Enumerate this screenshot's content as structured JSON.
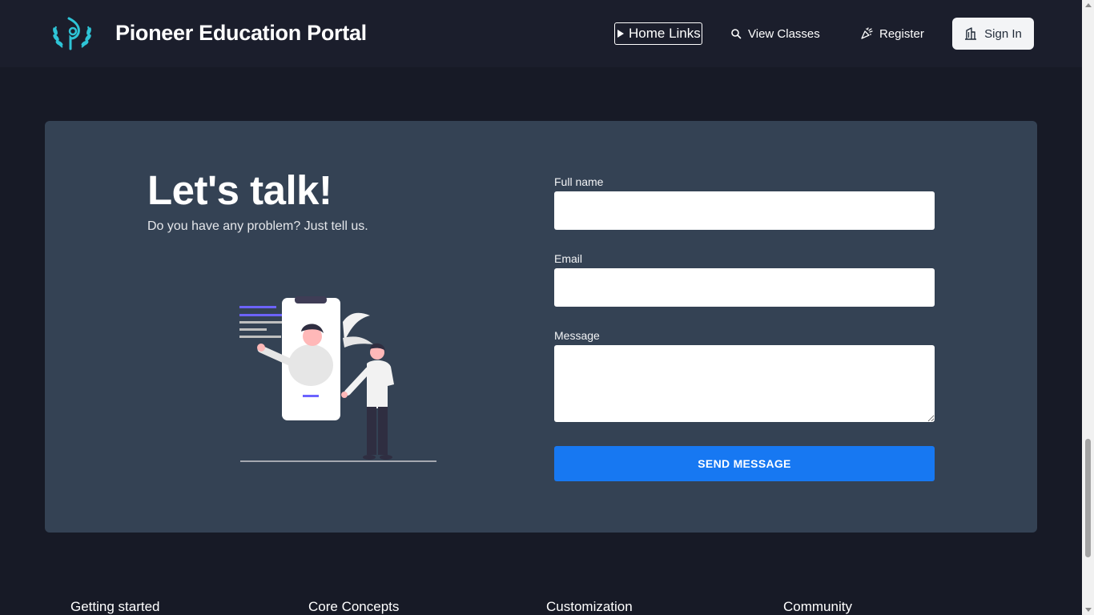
{
  "header": {
    "brand": "Pioneer Education Portal",
    "logo_icon": "laurel-p-logo-icon",
    "nav": {
      "home_links": "Home Links",
      "view_classes": "View Classes",
      "register": "Register",
      "sign_in": "Sign In"
    },
    "icons": {
      "home_links": "play-triangle-icon",
      "view_classes": "search-icon",
      "register": "party-popper-icon",
      "sign_in": "building-icon"
    }
  },
  "contact": {
    "title": "Let's talk!",
    "subtitle": "Do you have any problem? Just tell us.",
    "illustration": "person-video-call-illustration",
    "fields": {
      "full_name_label": "Full name",
      "email_label": "Email",
      "message_label": "Message",
      "full_name_value": "",
      "email_value": "",
      "message_value": ""
    },
    "submit_label": "SEND MESSAGE"
  },
  "footer": {
    "columns": [
      "Getting started",
      "Core Concepts",
      "Customization",
      "Community"
    ]
  },
  "colors": {
    "page_bg": "#171a26",
    "header_bg": "#1b1e2c",
    "card_bg": "#344254",
    "button_primary": "#1778f2",
    "accent_teal": "#2ec4d6",
    "accent_purple": "#6c63ff"
  }
}
